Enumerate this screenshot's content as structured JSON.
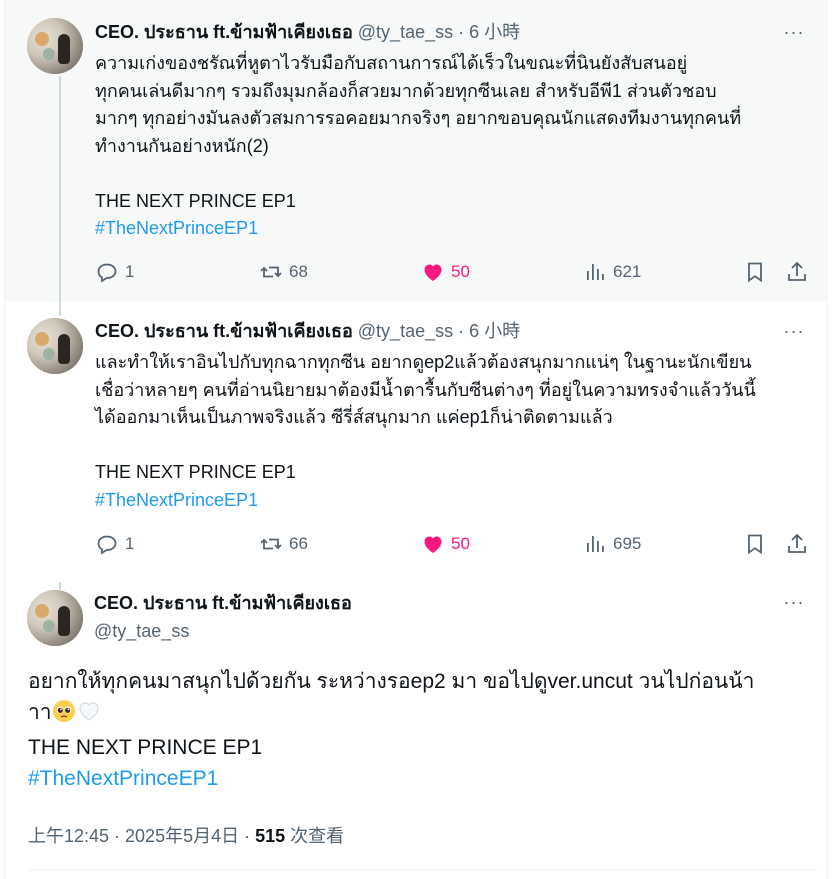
{
  "tweets": [
    {
      "name": "CEO. ประธาน ft.ข้ามฟ้าเคียงเธอ",
      "handle": "@ty_tae_ss",
      "sep": " · ",
      "time": "6 小時",
      "line1": "ความเก่งของชรัณที่หูตาไวรับมือกับสถานการณ์ได้เร็วในขณะที่นินยังสับสนอยู่",
      "line2": "ทุกคนเล่นดีมากๆ รวมถึงมุมกล้องก็สวยมากด้วยทุกซีนเลย สำหรับอีพี1 ส่วนตัวชอบ",
      "line3": "มากๆ ทุกอย่างมันลงตัวสมการรอคอยมากจริงๆ อยากขอบคุณนักแสดงทีมงานทุกคนที่",
      "line4": "ทำงานกันอย่างหนัก(2)",
      "show_title": "THE NEXT PRINCE EP1",
      "hashtag": "#TheNextPrinceEP1",
      "replies": "1",
      "reposts": "68",
      "likes": "50",
      "views": "621"
    },
    {
      "name": "CEO. ประธาน ft.ข้ามฟ้าเคียงเธอ",
      "handle": "@ty_tae_ss",
      "sep": " · ",
      "time": "6 小時",
      "line1": "และทำให้เราอินไปกับทุกฉากทุกซีน อยากดูep2แล้วต้องสนุกมากแน่ๆ ในฐานะนักเขียน",
      "line2": "เชื่อว่าหลายๆ คนที่อ่านนิยายมาต้องมีน้ำตารื้นกับซีนต่างๆ ที่อยู่ในความทรงจำแล้ววันนี้",
      "line3": "ได้ออกมาเห็นเป็นภาพจริงแล้ว ซีรี่ส์สนุกมาก แค่ep1ก็น่าติดตามแล้ว",
      "show_title": "THE NEXT PRINCE EP1",
      "hashtag": "#TheNextPrinceEP1",
      "replies": "1",
      "reposts": "66",
      "likes": "50",
      "views": "695"
    }
  ],
  "main": {
    "name": "CEO. ประธาน ft.ข้ามฟ้าเคียงเธอ",
    "handle": "@ty_tae_ss",
    "line1": "อยากให้ทุกคนมาสนุกไปด้วยกัน ระหว่างรอep2 มา ขอไปดูver.uncut วนไปก่อนน้า",
    "line2": "าา",
    "show_title": "THE NEXT PRINCE EP1",
    "hashtag": "#TheNextPrinceEP1",
    "timestamp": "上午12:45 · 2025年5月4日 · ",
    "views_count": "515",
    "views_label": " 次查看"
  },
  "more_glyph": "···",
  "colors": {
    "link": "#1d9bf0",
    "like": "#f91880",
    "muted": "#536471",
    "text": "#0f1419"
  },
  "icons": [
    "reply-icon",
    "repost-icon",
    "heart-icon",
    "views-icon",
    "bookmark-icon",
    "share-icon",
    "more-icon",
    "pleading-face-emoji",
    "white-heart-emoji"
  ]
}
